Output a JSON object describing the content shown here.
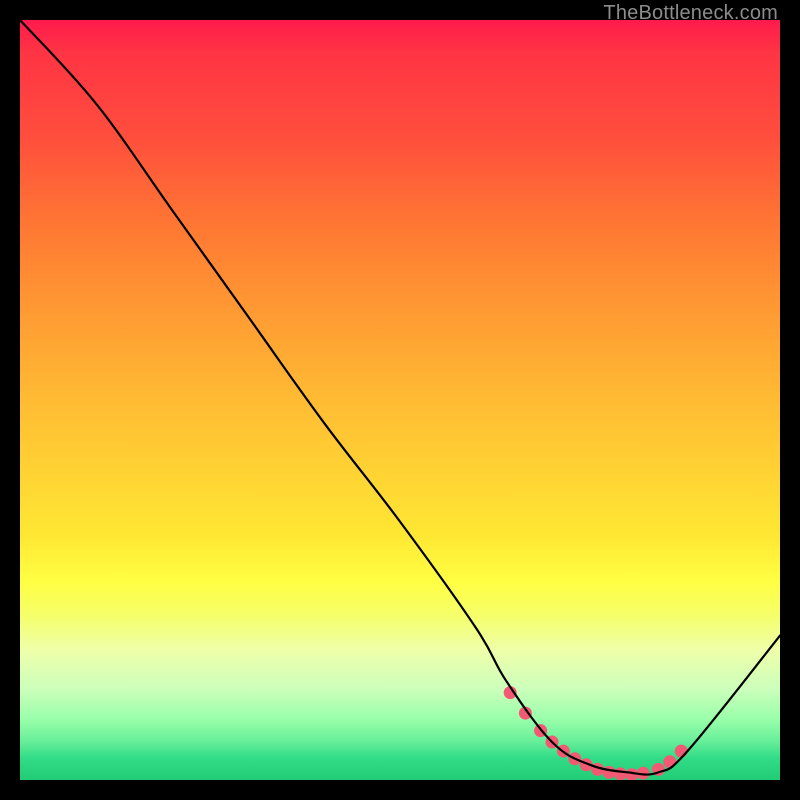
{
  "watermark": "TheBottleneck.com",
  "chart_data": {
    "type": "line",
    "title": "",
    "xlabel": "",
    "ylabel": "",
    "xlim": [
      0,
      100
    ],
    "ylim": [
      0,
      100
    ],
    "grid": false,
    "series": [
      {
        "name": "curve",
        "x": [
          0,
          10,
          20,
          30,
          40,
          50,
          60,
          64,
          70,
          75,
          80,
          84,
          88,
          100
        ],
        "y": [
          100,
          89,
          75,
          61,
          47,
          34,
          20,
          13,
          5,
          2,
          1,
          1,
          4,
          19
        ],
        "color": "#000000"
      }
    ],
    "markers": {
      "name": "optimum-band",
      "x": [
        64.5,
        66.5,
        68.5,
        70.0,
        71.5,
        73.0,
        74.5,
        76.0,
        77.5,
        79.0,
        80.5,
        82.0,
        84.0,
        85.5,
        87.0
      ],
      "y": [
        11.5,
        8.8,
        6.5,
        5.0,
        3.8,
        2.8,
        2.0,
        1.4,
        1.0,
        0.8,
        0.7,
        0.9,
        1.4,
        2.4,
        3.8
      ],
      "color": "#f25a74",
      "radius": 6.5
    }
  }
}
